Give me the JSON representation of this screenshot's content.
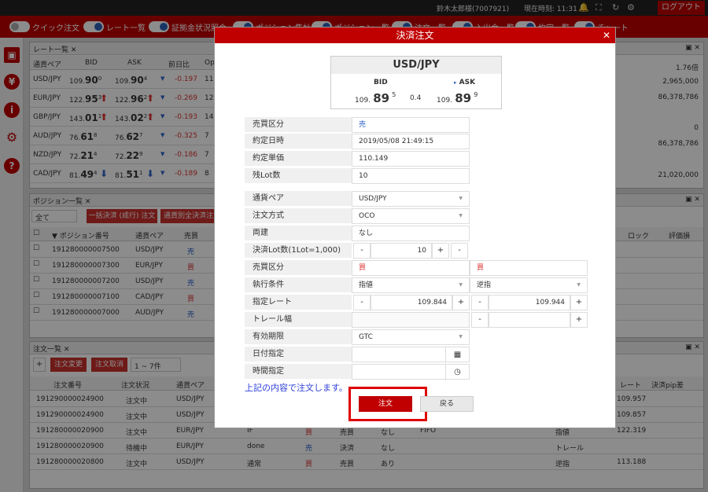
{
  "topbar": {
    "user": "鈴木太郎様(7007921)",
    "time_label": "現在時刻: 11:31",
    "logout": "ログアウト"
  },
  "toggles": [
    {
      "label": "クイック注文"
    },
    {
      "label": "レート一覧"
    },
    {
      "label": "証拠金状況照会"
    },
    {
      "label": "ポジション集計"
    },
    {
      "label": "ポジション一覧"
    },
    {
      "label": "注文一覧"
    },
    {
      "label": "入出金一覧"
    },
    {
      "label": "約定一覧"
    },
    {
      "label": "チャート"
    }
  ],
  "rate_panel": {
    "title": "レート一覧",
    "headers": [
      "通貨ペア",
      "BID",
      "ASK",
      "前日比",
      "Op"
    ],
    "rows": [
      {
        "pair": "USD/JPY",
        "bid_s": "109.",
        "bid_b": "90",
        "bid_p": "0",
        "ask_s": "109.",
        "ask_b": "90",
        "ask_p": "4",
        "arrow": "",
        "chg": "-0.197",
        "op": "11"
      },
      {
        "pair": "EUR/JPY",
        "bid_s": "122.",
        "bid_b": "95",
        "bid_p": "3",
        "ask_s": "122.",
        "ask_b": "96",
        "ask_p": "2",
        "arrow": "up",
        "chg": "-0.269",
        "op": "12"
      },
      {
        "pair": "GBP/JPY",
        "bid_s": "143.",
        "bid_b": "01",
        "bid_p": "1",
        "ask_s": "143.",
        "ask_b": "02",
        "ask_p": "2",
        "arrow": "up",
        "chg": "-0.193",
        "op": "14"
      },
      {
        "pair": "AUD/JPY",
        "bid_s": "76.",
        "bid_b": "61",
        "bid_p": "8",
        "ask_s": "76.",
        "ask_b": "62",
        "ask_p": "7",
        "arrow": "",
        "chg": "-0.325",
        "op": "7"
      },
      {
        "pair": "NZD/JPY",
        "bid_s": "72.",
        "bid_b": "21",
        "bid_p": "4",
        "ask_s": "72.",
        "ask_b": "22",
        "ask_p": "9",
        "arrow": "",
        "chg": "-0.186",
        "op": "7"
      },
      {
        "pair": "CAD/JPY",
        "bid_s": "81.",
        "bid_b": "49",
        "bid_p": "4",
        "ask_s": "81.",
        "ask_b": "51",
        "ask_p": "1",
        "arrow": "down",
        "chg": "-0.189",
        "op": "8"
      }
    ]
  },
  "margin_panel": {
    "values": [
      "1.76倍",
      "2,965,000",
      "86,378,786",
      "0",
      "86,378,786",
      "21,020,000"
    ]
  },
  "position_panel": {
    "title": "ポジション一覧",
    "filter": "全て",
    "btn_bulk": "一括決済 (成行) 注文",
    "btn_pair": "通貨別全決済注文",
    "headers": [
      "▼ ポジション番号",
      "通貨ペア",
      "売買"
    ],
    "right_headers": [
      "ロック",
      "評価損"
    ],
    "rows": [
      {
        "no": "191280000007500",
        "pair": "USD/JPY",
        "side": "売"
      },
      {
        "no": "191280000007300",
        "pair": "EUR/JPY",
        "side": "買"
      },
      {
        "no": "191280000007200",
        "pair": "USD/JPY",
        "side": "売"
      },
      {
        "no": "191280000007100",
        "pair": "CAD/JPY",
        "side": "買"
      },
      {
        "no": "191280000007000",
        "pair": "AUD/JPY",
        "side": "売"
      }
    ]
  },
  "order_panel": {
    "title": "注文一覧",
    "btn_change": "注文変更",
    "btn_cancel": "注文取消",
    "range": "1 ~ 7件",
    "headers": [
      "注文番号",
      "注文状況",
      "通貨ペア"
    ],
    "right_headers": [
      "レート",
      "決済pip差"
    ],
    "rows": [
      {
        "no": "191290000024900",
        "status": "注文中",
        "pair": "USD/JPY",
        "c4": "",
        "c5": "",
        "c6": "",
        "c7": "",
        "c8": "",
        "c9": "",
        "rate": "109.957"
      },
      {
        "no": "191290000024900",
        "status": "注文中",
        "pair": "USD/JPY",
        "c4": "",
        "c5": "",
        "c6": "",
        "c7": "",
        "c8": "",
        "c9": "",
        "rate": "109.857"
      },
      {
        "no": "191280000020900",
        "status": "注文中",
        "pair": "EUR/JPY",
        "c4": "IF",
        "c5": "買",
        "c6": "売買",
        "c7": "なし",
        "c8": "FIFO",
        "c9": "指値",
        "rate": "122.319"
      },
      {
        "no": "191280000020900",
        "status": "待機中",
        "pair": "EUR/JPY",
        "c4": "done",
        "c5": "売",
        "c6": "決済",
        "c7": "なし",
        "c8": "",
        "c9": "トレール",
        "rate": ""
      },
      {
        "no": "191280000020800",
        "status": "注文中",
        "pair": "USD/JPY",
        "c4": "通常",
        "c5": "買",
        "c6": "売買",
        "c7": "あり",
        "c8": "",
        "c9": "逆指",
        "rate": "113.188"
      }
    ]
  },
  "dialog": {
    "title": "決済注文",
    "pair": "USD/JPY",
    "bid_label": "BID",
    "ask_label": "ASK",
    "bid": {
      "small": "109.",
      "big": "89",
      "pip": "5"
    },
    "ask": {
      "small": "109.",
      "big": "89",
      "pip": "9"
    },
    "spread": "0.4",
    "info": [
      {
        "label": "売買区分",
        "value": "売"
      },
      {
        "label": "約定日時",
        "value": "2019/05/08 21:49:15"
      },
      {
        "label": "約定単価",
        "value": "110.149"
      },
      {
        "label": "残Lot数",
        "value": "10"
      }
    ],
    "currency_label": "通貨ペア",
    "currency_value": "USD/JPY",
    "method_label": "注文方式",
    "method_value": "OCO",
    "both_label": "両建",
    "both_value": "なし",
    "lot_label": "決済Lot数(1Lot=1,000)",
    "lot_value": "10",
    "side_label": "売買区分",
    "side_left": "買",
    "side_right": "買",
    "cond_label": "執行条件",
    "cond_left": "指値",
    "cond_right": "逆指",
    "rate_label": "指定レート",
    "rate_left": "109.844",
    "rate_right": "109.944",
    "trail_label": "トレール幅",
    "expiry_label": "有効期限",
    "expiry_value": "GTC",
    "date_label": "日付指定",
    "time_label": "時間指定",
    "minus": "-",
    "plus": "+",
    "notice": "上記の内容で注文します。",
    "ok": "注文",
    "back": "戻る"
  }
}
